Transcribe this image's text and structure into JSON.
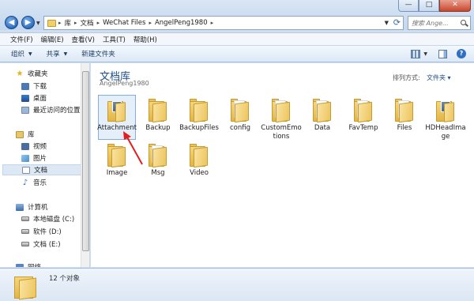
{
  "window": {
    "minimize": "—",
    "maximize": "□",
    "close": "✕"
  },
  "nav": {
    "back": "◀",
    "forward": "▶"
  },
  "address": {
    "crumbs": [
      "库",
      "文档",
      "WeChat Files",
      "AngelPeng1980"
    ]
  },
  "search": {
    "placeholder": "搜索 Ange..."
  },
  "menubar": {
    "items": [
      "文件(F)",
      "编辑(E)",
      "查看(V)",
      "工具(T)",
      "帮助(H)"
    ]
  },
  "toolbar": {
    "organize": "组织",
    "share": "共享",
    "new_folder": "新建文件夹"
  },
  "sidebar": {
    "favorites": "收藏夹",
    "downloads": "下载",
    "desktop": "桌面",
    "recent": "最近访问的位置",
    "libraries": "库",
    "videos": "视频",
    "pictures": "图片",
    "documents": "文档",
    "music": "音乐",
    "computer": "计算机",
    "drive_c": "本地磁盘 (C:)",
    "drive_d": "软件 (D:)",
    "drive_e": "文档 (E:)",
    "network": "网络"
  },
  "library": {
    "title": "文档库",
    "subtitle": "AngelPeng1980",
    "arrange_label": "排列方式:",
    "arrange_value": "文件夹 ▾"
  },
  "items": [
    {
      "label": "Attachment"
    },
    {
      "label": "Backup"
    },
    {
      "label": "BackupFiles"
    },
    {
      "label": "config"
    },
    {
      "label": "CustomEmotions"
    },
    {
      "label": "Data"
    },
    {
      "label": "FavTemp"
    },
    {
      "label": "Files"
    },
    {
      "label": "HDHeadImage"
    },
    {
      "label": "Image"
    },
    {
      "label": "Msg"
    },
    {
      "label": "Video"
    }
  ],
  "details": {
    "count": "12 个对象"
  },
  "colors": {
    "accent": "#1e4e8c",
    "annotation": "#e02020"
  }
}
